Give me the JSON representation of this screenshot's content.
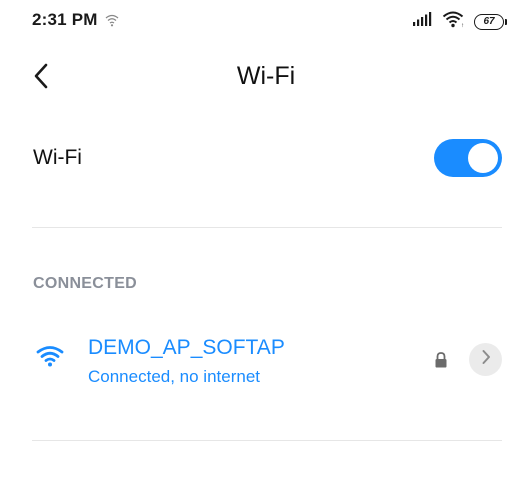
{
  "status_bar": {
    "time": "2:31 PM",
    "battery": "67",
    "icons": [
      "wifi-small-icon",
      "signal-icon",
      "wifi-icon",
      "battery-icon"
    ]
  },
  "header": {
    "title": "Wi-Fi",
    "back_icon": "chevron-left-icon"
  },
  "wifi_toggle": {
    "label": "Wi-Fi",
    "enabled": true
  },
  "connected_section": {
    "label": "CONNECTED",
    "network": {
      "ssid": "DEMO_AP_SOFTAP",
      "status": "Connected, no internet",
      "secured": true
    }
  },
  "colors": {
    "accent": "#1a8cff",
    "section_label": "#8a8f99",
    "divider": "#e6e6e6",
    "detail_button_bg": "#ebebeb"
  }
}
